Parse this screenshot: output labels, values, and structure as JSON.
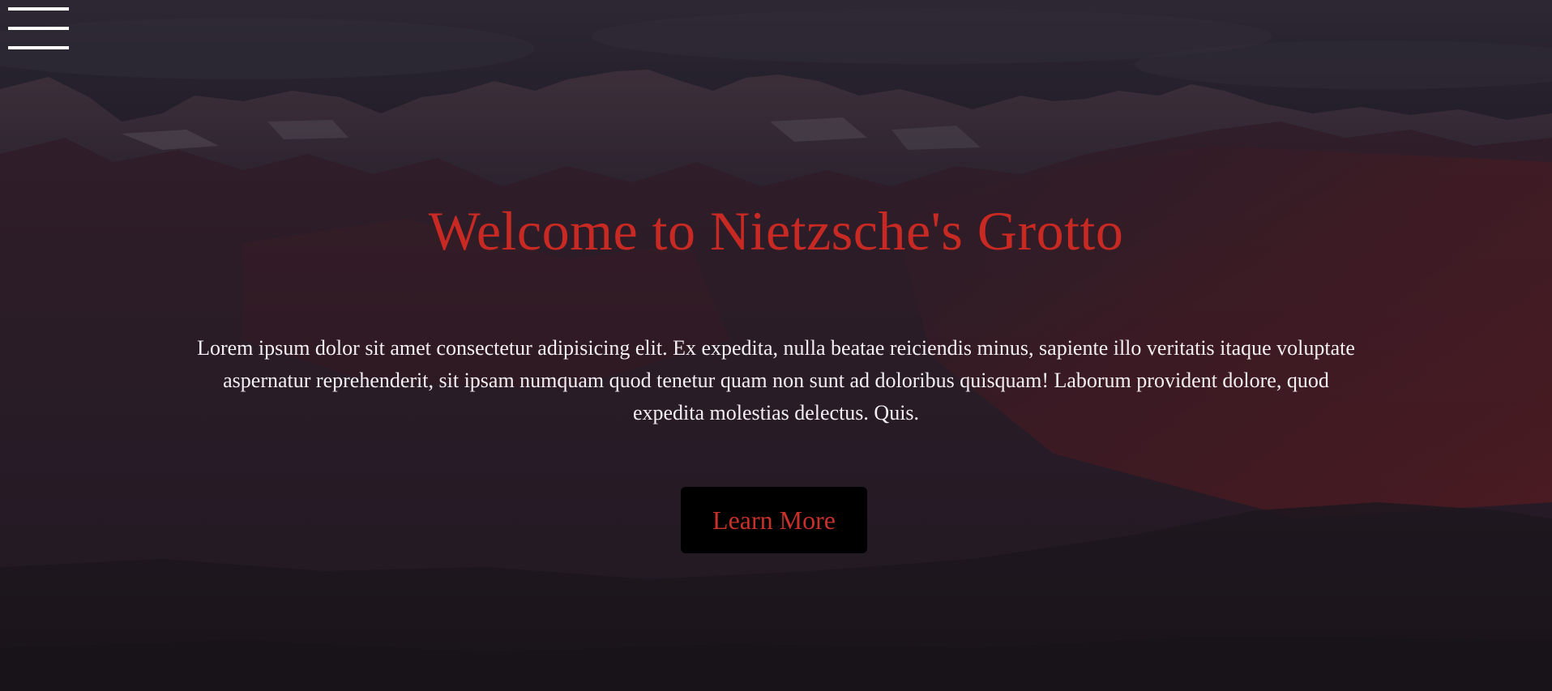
{
  "hero": {
    "title": "Welcome to Nietzsche's Grotto",
    "body": "Lorem ipsum dolor sit amet consectetur adipisicing elit. Ex expedita, nulla beatae reiciendis minus, sapiente illo veritatis itaque voluptate aspernatur reprehenderit, sit ipsam numquam quod tenetur quam non sunt ad doloribus quisquam! Laborum provident dolore, quod expedita molestias delectus. Quis.",
    "cta_label": "Learn More"
  },
  "nav": {
    "menu_icon": "hamburger-menu-icon"
  },
  "colors": {
    "accent": "#c82a23",
    "text": "#f3eff2",
    "button_bg": "#000000",
    "background": "#201b24"
  }
}
